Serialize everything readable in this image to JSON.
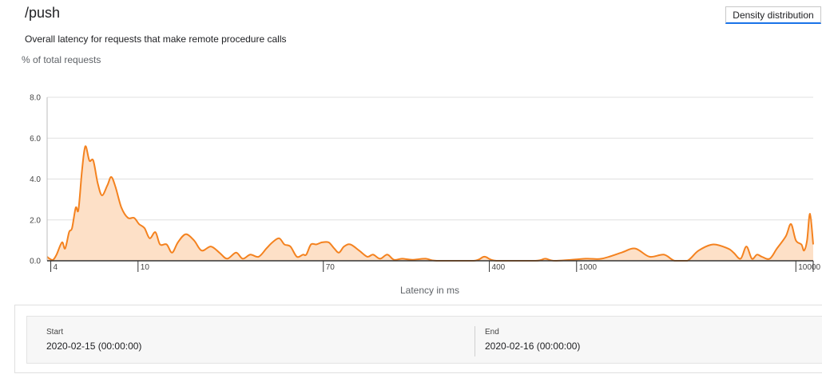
{
  "header": {
    "title": "/push",
    "subtitle": "Overall latency for requests that make remote procedure calls",
    "density_button_label": "Density distribution"
  },
  "chart_data": {
    "type": "area",
    "ylabel": "% of total requests",
    "xlabel": "Latency in ms",
    "x_scale": "log",
    "xlim": [
      3.85,
      12000
    ],
    "ylim": [
      0,
      8
    ],
    "y_ticks": [
      {
        "value": 0,
        "label": "0.0"
      },
      {
        "value": 2,
        "label": "2.0"
      },
      {
        "value": 4,
        "label": "4.0"
      },
      {
        "value": 6,
        "label": "6.0"
      },
      {
        "value": 8,
        "label": "8.0"
      }
    ],
    "x_ticks": [
      {
        "value": 4,
        "label": "4"
      },
      {
        "value": 10,
        "label": "10"
      },
      {
        "value": 70,
        "label": "70"
      },
      {
        "value": 400,
        "label": "400"
      },
      {
        "value": 1000,
        "label": "1000"
      },
      {
        "value": 10000,
        "label": "10000"
      }
    ],
    "grid": "horizontal",
    "colors": {
      "line": "#f4821f",
      "fill": "#fde0c7",
      "grid": "#e0e0e0",
      "axis": "#333333"
    },
    "series": [
      {
        "points": [
          [
            3.85,
            0.2
          ],
          [
            3.95,
            0.1
          ],
          [
            4.1,
            0.05
          ],
          [
            4.25,
            0.3
          ],
          [
            4.5,
            0.9
          ],
          [
            4.65,
            0.6
          ],
          [
            4.85,
            1.4
          ],
          [
            5.0,
            1.6
          ],
          [
            5.2,
            2.6
          ],
          [
            5.35,
            2.5
          ],
          [
            5.55,
            4.4
          ],
          [
            5.75,
            5.6
          ],
          [
            6.0,
            4.9
          ],
          [
            6.25,
            4.9
          ],
          [
            6.55,
            3.8
          ],
          [
            6.85,
            3.2
          ],
          [
            7.25,
            3.7
          ],
          [
            7.55,
            4.1
          ],
          [
            7.9,
            3.6
          ],
          [
            8.4,
            2.6
          ],
          [
            9.0,
            2.1
          ],
          [
            9.6,
            2.1
          ],
          [
            10.1,
            1.8
          ],
          [
            10.7,
            1.6
          ],
          [
            11.3,
            1.1
          ],
          [
            12.0,
            1.4
          ],
          [
            12.6,
            0.8
          ],
          [
            13.5,
            0.8
          ],
          [
            14.3,
            0.4
          ],
          [
            15.2,
            0.9
          ],
          [
            16.5,
            1.3
          ],
          [
            18.0,
            1.0
          ],
          [
            19.5,
            0.5
          ],
          [
            21.5,
            0.7
          ],
          [
            23.5,
            0.4
          ],
          [
            25.5,
            0.1
          ],
          [
            28.0,
            0.4
          ],
          [
            30.0,
            0.1
          ],
          [
            32.5,
            0.3
          ],
          [
            35.5,
            0.2
          ],
          [
            38.5,
            0.6
          ],
          [
            41.0,
            0.9
          ],
          [
            44.0,
            1.1
          ],
          [
            46.5,
            0.8
          ],
          [
            49.5,
            0.7
          ],
          [
            53.0,
            0.2
          ],
          [
            56.5,
            0.3
          ],
          [
            58.5,
            0.3
          ],
          [
            61.5,
            0.8
          ],
          [
            65.0,
            0.8
          ],
          [
            69.0,
            0.9
          ],
          [
            74.0,
            0.9
          ],
          [
            78.5,
            0.6
          ],
          [
            82.5,
            0.4
          ],
          [
            87.0,
            0.7
          ],
          [
            93.0,
            0.8
          ],
          [
            102.0,
            0.5
          ],
          [
            111.0,
            0.2
          ],
          [
            118.0,
            0.3
          ],
          [
            127.0,
            0.1
          ],
          [
            137.0,
            0.3
          ],
          [
            147.0,
            0.05
          ],
          [
            160.0,
            0.1
          ],
          [
            178.0,
            0.05
          ],
          [
            205.0,
            0.1
          ],
          [
            230.0,
            0.0
          ],
          [
            340.0,
            0.0
          ],
          [
            380.0,
            0.2
          ],
          [
            430.0,
            0.0
          ],
          [
            650.0,
            0.0
          ],
          [
            720.0,
            0.1
          ],
          [
            800.0,
            0.0
          ],
          [
            1100.0,
            0.1
          ],
          [
            1300.0,
            0.1
          ],
          [
            1600.0,
            0.4
          ],
          [
            1850.0,
            0.6
          ],
          [
            2150.0,
            0.2
          ],
          [
            2500.0,
            0.3
          ],
          [
            2800.0,
            0.0
          ],
          [
            3200.0,
            0.0
          ],
          [
            3600.0,
            0.5
          ],
          [
            4200.0,
            0.8
          ],
          [
            4900.0,
            0.6
          ],
          [
            5200.0,
            0.4
          ],
          [
            5600.0,
            0.1
          ],
          [
            5950.0,
            0.7
          ],
          [
            6300.0,
            0.1
          ],
          [
            6650.0,
            0.3
          ],
          [
            7000.0,
            0.2
          ],
          [
            7600.0,
            0.1
          ],
          [
            8200.0,
            0.6
          ],
          [
            9000.0,
            1.2
          ],
          [
            9500.0,
            1.8
          ],
          [
            10000.0,
            1.0
          ],
          [
            10600.0,
            0.8
          ],
          [
            10900.0,
            0.5
          ],
          [
            11250.0,
            1.0
          ],
          [
            11600.0,
            2.3
          ],
          [
            12000.0,
            0.8
          ]
        ]
      }
    ]
  },
  "time_range": {
    "start_label": "Start",
    "start_value": "2020-02-15 (00:00:00)",
    "end_label": "End",
    "end_value": "2020-02-16 (00:00:00)"
  }
}
